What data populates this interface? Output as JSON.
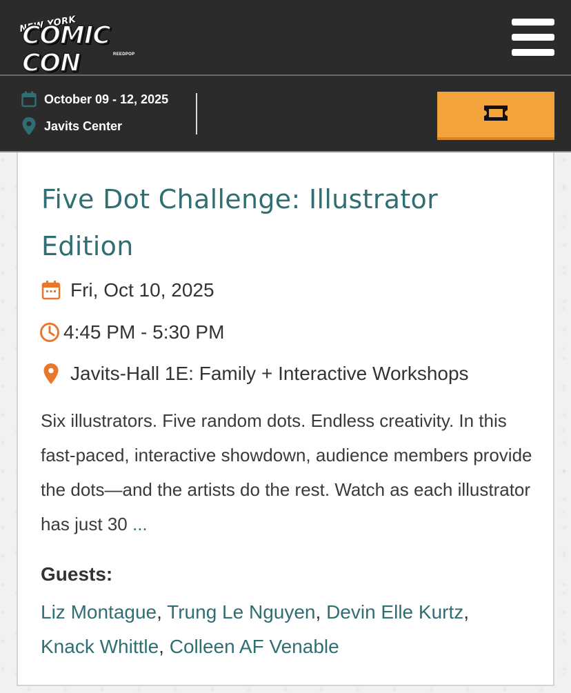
{
  "header": {
    "logo_line1": "NEW YORK",
    "logo_line2": "COMIC CON",
    "logo_sub": "REEDPOP",
    "menu_icon": "hamburger-icon"
  },
  "event_info": {
    "dates": "October 09 - 12, 2025",
    "venue": "Javits Center",
    "calendar_icon": "calendar-icon",
    "location_icon": "location-pin-icon",
    "ticket_icon": "ticket-icon"
  },
  "session": {
    "title": "Five Dot Challenge: Illustrator Edition",
    "date": "Fri, Oct 10, 2025",
    "time": "4:45 PM - 5:30 PM",
    "location": "Javits-Hall 1E: Family + Interactive Workshops",
    "description": "Six illustrators. Five random dots. Endless creativity. In this fast-paced, interactive showdown, audience members provide the dots—and the artists do the rest. Watch as each illustrator has just 30",
    "more_label": "...",
    "guests_label": "Guests:",
    "guests": [
      "Liz Montague",
      "Trung Le Nguyen",
      "Devin Elle Kurtz",
      "Knack Whittle",
      "Colleen AF Venable"
    ]
  },
  "colors": {
    "header_bg": "#2b2b2b",
    "accent_orange": "#f2a33c",
    "teal": "#2f6e72",
    "icon_orange": "#e8762d"
  }
}
